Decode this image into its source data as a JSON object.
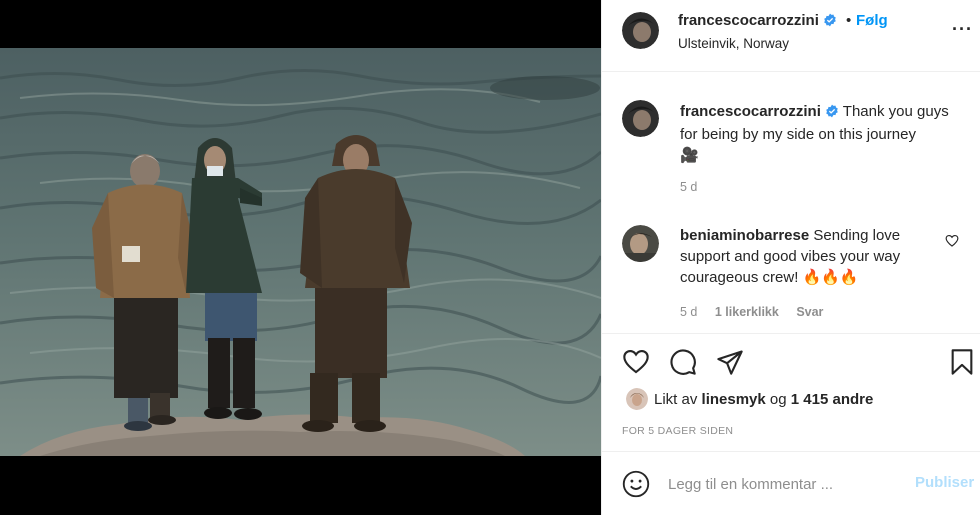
{
  "header": {
    "username": "francescocarrozzini",
    "separator": "•",
    "follow_label": "Følg",
    "location": "Ulsteinvik, Norway",
    "more_label": "···"
  },
  "caption": {
    "username": "francescocarrozzini",
    "text": "Thank you guys for being by my side on this journey",
    "emoji": "🎥",
    "time": "5 d"
  },
  "comments": [
    {
      "username": "beniaminobarrese",
      "text": "Sending love support and good vibes your way courageous crew!",
      "emoji": "🔥🔥🔥",
      "time": "5 d",
      "likes": "1 likerklikk",
      "reply_label": "Svar"
    }
  ],
  "likes": {
    "prefix": "Likt av",
    "user": "linesmyk",
    "joiner": "og",
    "others": "1 415 andre"
  },
  "timestamp": "FOR 5 DAGER SIDEN",
  "add_comment": {
    "placeholder": "Legg til en kommentar ...",
    "publish_label": "Publiser"
  },
  "icons": {
    "verified": "verified-badge-icon",
    "like": "heart-icon",
    "comment": "comment-bubble-icon",
    "share": "paper-plane-icon",
    "save": "bookmark-icon",
    "emoji": "smiley-icon"
  },
  "colors": {
    "accent": "#0095f6",
    "publish_disabled": "#b2dffc",
    "muted": "#8e8e8e",
    "text": "#262626"
  }
}
